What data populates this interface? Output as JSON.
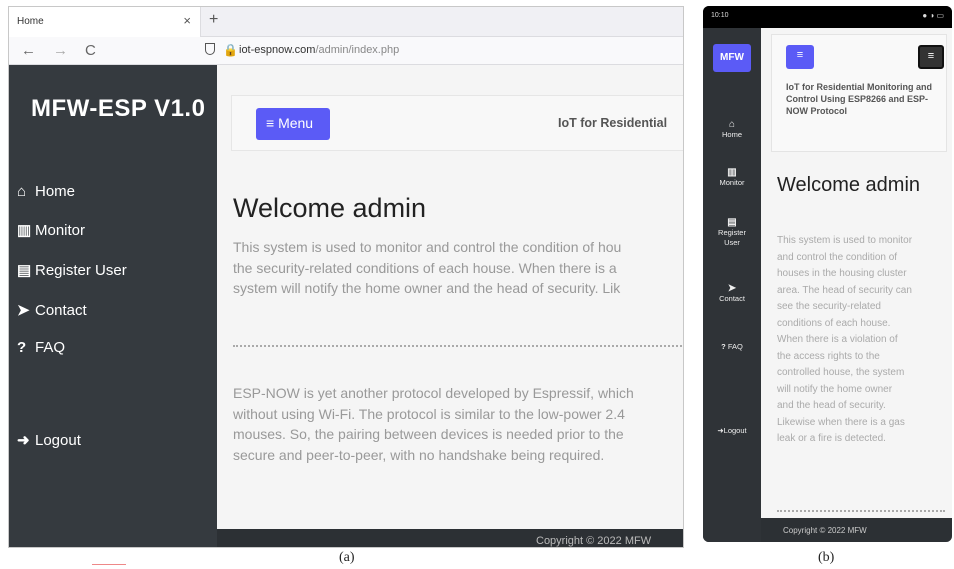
{
  "panel_a": {
    "tab_title": "Home",
    "tab_close": "×",
    "new_tab": "+",
    "back": "←",
    "forward": "→",
    "reload": "C",
    "url_host": "iot-espnow.com",
    "url_path": "/admin/index.php",
    "brand": "MFW-ESP V1.0",
    "menu_button": "Menu",
    "app_title": "IoT for Residential",
    "sidebar": [
      {
        "icon": "home-icon",
        "glyph": "⌂",
        "label": "Home"
      },
      {
        "icon": "chart-icon",
        "glyph": "▥",
        "label": "Monitor"
      },
      {
        "icon": "user-card-icon",
        "glyph": "▤",
        "label": "Register User"
      },
      {
        "icon": "paper-plane-icon",
        "glyph": "➤",
        "label": "Contact"
      },
      {
        "icon": "question-icon",
        "glyph": "?",
        "label": "FAQ"
      },
      {
        "icon": "logout-icon",
        "glyph": "➜",
        "label": "Logout"
      }
    ],
    "welcome": "Welcome admin",
    "para1": [
      "This system is used to monitor and control the condition of hou",
      "the security-related conditions of each house. When there is a",
      "system will notify the home owner and the head of security. Lik"
    ],
    "para2": [
      "ESP-NOW is yet another protocol developed by Espressif, which",
      "without using Wi-Fi. The protocol is similar to the low-power 2.4",
      "mouses. So, the pairing between devices is needed prior to the",
      "secure and peer-to-peer, with no handshake being required."
    ],
    "footer": "Copyright © 2022 MFW"
  },
  "panel_b": {
    "time": "10:10",
    "brand": "MFW",
    "app_title": "IoT for Residential Monitoring and Control Using ESP8266 and ESP-NOW Protocol",
    "sidebar": [
      {
        "icon": "home-icon",
        "glyph": "⌂",
        "label": "Home"
      },
      {
        "icon": "chart-icon",
        "glyph": "▥",
        "label": "Monitor"
      },
      {
        "icon": "user-card-icon",
        "glyph": "▤",
        "label": "Register User"
      },
      {
        "icon": "paper-plane-icon",
        "glyph": "➤",
        "label": "Contact"
      },
      {
        "icon": "question-icon",
        "glyph": "?",
        "label": "FAQ"
      },
      {
        "icon": "logout-icon",
        "glyph": "➜",
        "label": "Logout"
      }
    ],
    "welcome": "Welcome admin",
    "para": [
      "This system is used to monitor",
      "and control the condition of",
      "houses in the housing cluster",
      "area. The head of security can",
      "see the security-related",
      "conditions of each house.",
      "When there is a violation of",
      "the access rights to the",
      "controlled house, the system",
      "will notify the home owner",
      "and the head of security.",
      "Likewise when there is a gas",
      "leak or a fire is detected."
    ],
    "footer": "Copyright © 2022 MFW"
  },
  "captions": {
    "a": "(a)",
    "b": "(b)"
  },
  "colors": {
    "accent": "#5b5bf6",
    "sidebar": "#353a3f",
    "footer": "#2c3034"
  }
}
